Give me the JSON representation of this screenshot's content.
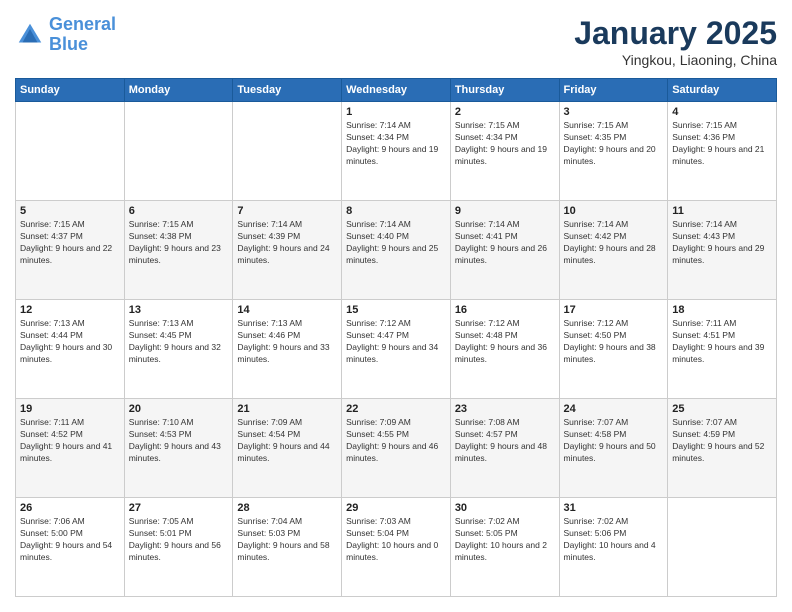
{
  "header": {
    "logo_line1": "General",
    "logo_line2": "Blue",
    "month_title": "January 2025",
    "location": "Yingkou, Liaoning, China"
  },
  "weekdays": [
    "Sunday",
    "Monday",
    "Tuesday",
    "Wednesday",
    "Thursday",
    "Friday",
    "Saturday"
  ],
  "weeks": [
    [
      {
        "day": "",
        "sunrise": "",
        "sunset": "",
        "daylight": ""
      },
      {
        "day": "",
        "sunrise": "",
        "sunset": "",
        "daylight": ""
      },
      {
        "day": "",
        "sunrise": "",
        "sunset": "",
        "daylight": ""
      },
      {
        "day": "1",
        "sunrise": "Sunrise: 7:14 AM",
        "sunset": "Sunset: 4:34 PM",
        "daylight": "Daylight: 9 hours and 19 minutes."
      },
      {
        "day": "2",
        "sunrise": "Sunrise: 7:15 AM",
        "sunset": "Sunset: 4:34 PM",
        "daylight": "Daylight: 9 hours and 19 minutes."
      },
      {
        "day": "3",
        "sunrise": "Sunrise: 7:15 AM",
        "sunset": "Sunset: 4:35 PM",
        "daylight": "Daylight: 9 hours and 20 minutes."
      },
      {
        "day": "4",
        "sunrise": "Sunrise: 7:15 AM",
        "sunset": "Sunset: 4:36 PM",
        "daylight": "Daylight: 9 hours and 21 minutes."
      }
    ],
    [
      {
        "day": "5",
        "sunrise": "Sunrise: 7:15 AM",
        "sunset": "Sunset: 4:37 PM",
        "daylight": "Daylight: 9 hours and 22 minutes."
      },
      {
        "day": "6",
        "sunrise": "Sunrise: 7:15 AM",
        "sunset": "Sunset: 4:38 PM",
        "daylight": "Daylight: 9 hours and 23 minutes."
      },
      {
        "day": "7",
        "sunrise": "Sunrise: 7:14 AM",
        "sunset": "Sunset: 4:39 PM",
        "daylight": "Daylight: 9 hours and 24 minutes."
      },
      {
        "day": "8",
        "sunrise": "Sunrise: 7:14 AM",
        "sunset": "Sunset: 4:40 PM",
        "daylight": "Daylight: 9 hours and 25 minutes."
      },
      {
        "day": "9",
        "sunrise": "Sunrise: 7:14 AM",
        "sunset": "Sunset: 4:41 PM",
        "daylight": "Daylight: 9 hours and 26 minutes."
      },
      {
        "day": "10",
        "sunrise": "Sunrise: 7:14 AM",
        "sunset": "Sunset: 4:42 PM",
        "daylight": "Daylight: 9 hours and 28 minutes."
      },
      {
        "day": "11",
        "sunrise": "Sunrise: 7:14 AM",
        "sunset": "Sunset: 4:43 PM",
        "daylight": "Daylight: 9 hours and 29 minutes."
      }
    ],
    [
      {
        "day": "12",
        "sunrise": "Sunrise: 7:13 AM",
        "sunset": "Sunset: 4:44 PM",
        "daylight": "Daylight: 9 hours and 30 minutes."
      },
      {
        "day": "13",
        "sunrise": "Sunrise: 7:13 AM",
        "sunset": "Sunset: 4:45 PM",
        "daylight": "Daylight: 9 hours and 32 minutes."
      },
      {
        "day": "14",
        "sunrise": "Sunrise: 7:13 AM",
        "sunset": "Sunset: 4:46 PM",
        "daylight": "Daylight: 9 hours and 33 minutes."
      },
      {
        "day": "15",
        "sunrise": "Sunrise: 7:12 AM",
        "sunset": "Sunset: 4:47 PM",
        "daylight": "Daylight: 9 hours and 34 minutes."
      },
      {
        "day": "16",
        "sunrise": "Sunrise: 7:12 AM",
        "sunset": "Sunset: 4:48 PM",
        "daylight": "Daylight: 9 hours and 36 minutes."
      },
      {
        "day": "17",
        "sunrise": "Sunrise: 7:12 AM",
        "sunset": "Sunset: 4:50 PM",
        "daylight": "Daylight: 9 hours and 38 minutes."
      },
      {
        "day": "18",
        "sunrise": "Sunrise: 7:11 AM",
        "sunset": "Sunset: 4:51 PM",
        "daylight": "Daylight: 9 hours and 39 minutes."
      }
    ],
    [
      {
        "day": "19",
        "sunrise": "Sunrise: 7:11 AM",
        "sunset": "Sunset: 4:52 PM",
        "daylight": "Daylight: 9 hours and 41 minutes."
      },
      {
        "day": "20",
        "sunrise": "Sunrise: 7:10 AM",
        "sunset": "Sunset: 4:53 PM",
        "daylight": "Daylight: 9 hours and 43 minutes."
      },
      {
        "day": "21",
        "sunrise": "Sunrise: 7:09 AM",
        "sunset": "Sunset: 4:54 PM",
        "daylight": "Daylight: 9 hours and 44 minutes."
      },
      {
        "day": "22",
        "sunrise": "Sunrise: 7:09 AM",
        "sunset": "Sunset: 4:55 PM",
        "daylight": "Daylight: 9 hours and 46 minutes."
      },
      {
        "day": "23",
        "sunrise": "Sunrise: 7:08 AM",
        "sunset": "Sunset: 4:57 PM",
        "daylight": "Daylight: 9 hours and 48 minutes."
      },
      {
        "day": "24",
        "sunrise": "Sunrise: 7:07 AM",
        "sunset": "Sunset: 4:58 PM",
        "daylight": "Daylight: 9 hours and 50 minutes."
      },
      {
        "day": "25",
        "sunrise": "Sunrise: 7:07 AM",
        "sunset": "Sunset: 4:59 PM",
        "daylight": "Daylight: 9 hours and 52 minutes."
      }
    ],
    [
      {
        "day": "26",
        "sunrise": "Sunrise: 7:06 AM",
        "sunset": "Sunset: 5:00 PM",
        "daylight": "Daylight: 9 hours and 54 minutes."
      },
      {
        "day": "27",
        "sunrise": "Sunrise: 7:05 AM",
        "sunset": "Sunset: 5:01 PM",
        "daylight": "Daylight: 9 hours and 56 minutes."
      },
      {
        "day": "28",
        "sunrise": "Sunrise: 7:04 AM",
        "sunset": "Sunset: 5:03 PM",
        "daylight": "Daylight: 9 hours and 58 minutes."
      },
      {
        "day": "29",
        "sunrise": "Sunrise: 7:03 AM",
        "sunset": "Sunset: 5:04 PM",
        "daylight": "Daylight: 10 hours and 0 minutes."
      },
      {
        "day": "30",
        "sunrise": "Sunrise: 7:02 AM",
        "sunset": "Sunset: 5:05 PM",
        "daylight": "Daylight: 10 hours and 2 minutes."
      },
      {
        "day": "31",
        "sunrise": "Sunrise: 7:02 AM",
        "sunset": "Sunset: 5:06 PM",
        "daylight": "Daylight: 10 hours and 4 minutes."
      },
      {
        "day": "",
        "sunrise": "",
        "sunset": "",
        "daylight": ""
      }
    ]
  ]
}
